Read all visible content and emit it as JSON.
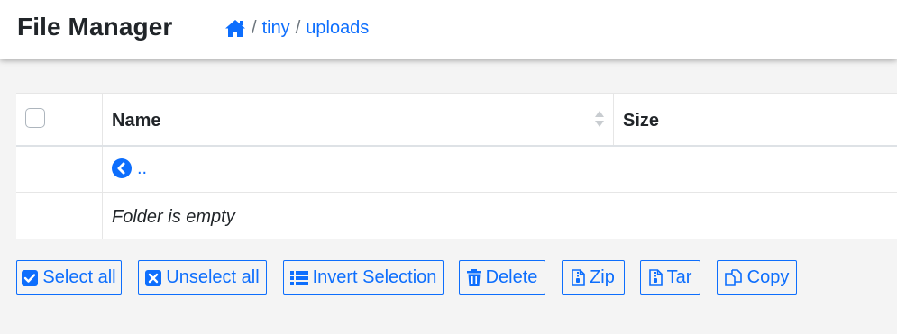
{
  "header": {
    "title": "File Manager",
    "breadcrumb": {
      "home_icon": "home-icon",
      "separator": "/",
      "items": [
        "tiny",
        "uploads"
      ]
    }
  },
  "table": {
    "columns": {
      "name": "Name",
      "size": "Size"
    },
    "parent_link": "..",
    "empty_message": "Folder is empty"
  },
  "actions": {
    "select_all": "Select all",
    "unselect_all": "Unselect all",
    "invert_selection": "Invert Selection",
    "delete": "Delete",
    "zip": "Zip",
    "tar": "Tar",
    "copy": "Copy"
  },
  "colors": {
    "accent": "#0d6efd",
    "background": "#f4f4f4",
    "text": "#212529"
  }
}
